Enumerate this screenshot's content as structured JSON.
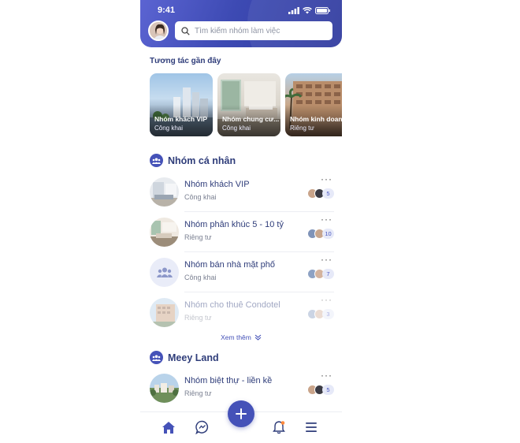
{
  "status_bar": {
    "time": "9:41"
  },
  "search": {
    "placeholder": "Tìm kiếm nhóm làm việc"
  },
  "recent": {
    "title": "Tương tác gần đây",
    "cards": [
      {
        "title": "Nhóm khách VIP",
        "subtitle": "Công khai"
      },
      {
        "title": "Nhóm chung cư...",
        "subtitle": "Công khai"
      },
      {
        "title": "Nhóm kinh doanh",
        "subtitle": "Riêng tư"
      }
    ]
  },
  "personal": {
    "title": "Nhóm cá nhân",
    "groups": [
      {
        "name": "Nhóm khách VIP",
        "privacy": "Công khai",
        "members": "5",
        "more": "···"
      },
      {
        "name": "Nhóm phân khúc 5 - 10 tỷ",
        "privacy": "Riêng tư",
        "members": "10",
        "more": "···"
      },
      {
        "name": "Nhóm bán nhà mặt phố",
        "privacy": "Công khai",
        "members": "7",
        "more": "···"
      },
      {
        "name": "Nhóm cho thuê Condotel",
        "privacy": "Riêng tư",
        "members": "3",
        "more": "···"
      }
    ],
    "see_more": "Xem thêm"
  },
  "meey": {
    "title": "Meey Land",
    "groups": [
      {
        "name": "Nhóm biệt thự - liền kề",
        "privacy": "Riêng tư",
        "members": "5",
        "more": "···"
      }
    ]
  },
  "icons": {
    "search": "search-icon",
    "group": "group-icon",
    "home": "home-icon",
    "chat": "chat-icon",
    "add": "plus-icon",
    "bell": "bell-icon",
    "menu": "menu-icon"
  },
  "colors": {
    "primary": "#4552b8",
    "title": "#2f3d7a",
    "notification_dot": "#ff8a3d"
  }
}
